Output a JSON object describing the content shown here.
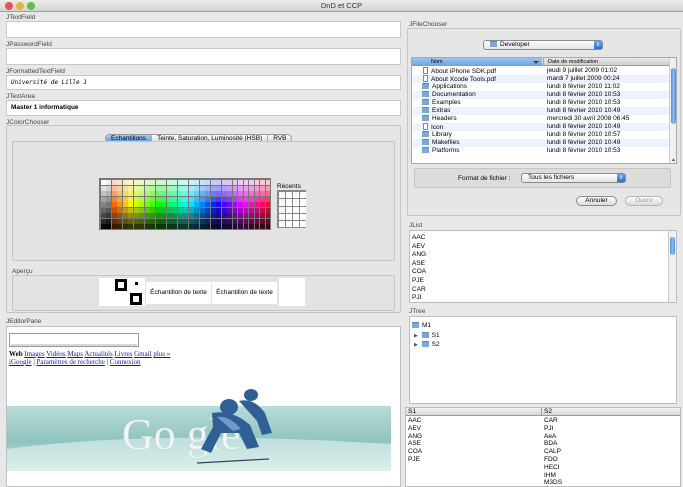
{
  "window": {
    "title": "DnD et CCP"
  },
  "colors": {
    "selection_blue": "#5d9be3",
    "list_header_blue": "#7ab0ea",
    "button_blue": "#2c6fd2"
  },
  "textfield": {
    "label": "JTextField",
    "value": ""
  },
  "passwordfield": {
    "label": "JPasswordField",
    "value": ""
  },
  "formattedfield": {
    "label": "JFormattedTextField",
    "value": "Université de Lille 1"
  },
  "textarea": {
    "label": "JTextArea",
    "value": "Master 1 informatique"
  },
  "colorchooser": {
    "label": "JColorChooser",
    "tabs": [
      "Échantillons",
      "Teinte, Saturation, Luminosité (HSB)",
      "RVB"
    ],
    "selected_tab": 0,
    "recents_label": "Récents",
    "preview_label": "Aperçu",
    "sample_text_1": "Échantillon de texte",
    "sample_text_2": "Échantillon de texte"
  },
  "editorpane": {
    "label": "JEditorPane",
    "links_row1": [
      "Web",
      "Images",
      "Vidéos",
      "Maps",
      "Actualités",
      "Livres",
      "Gmail",
      "plus »"
    ],
    "links_row2": [
      "iGoogle",
      "Paramètres de recherche",
      "Connexion"
    ],
    "sep": "|"
  },
  "filechooser": {
    "label": "JFileChooser",
    "folder": "Developer",
    "columns": [
      "Nom",
      "Date de modification"
    ],
    "files": [
      {
        "name": "About iPhone SDK.pdf",
        "date": "jeudi 9 juillet 2009 01:02",
        "icon": "document-icon"
      },
      {
        "name": "About Xcode Tools.pdf",
        "date": "mardi 7 juillet 2009 00:24",
        "icon": "document-icon"
      },
      {
        "name": "Applications",
        "date": "lundi 8 février 2010 11:02",
        "icon": "folder-icon"
      },
      {
        "name": "Documentation",
        "date": "lundi 8 février 2010 10:53",
        "icon": "folder-icon"
      },
      {
        "name": "Examples",
        "date": "lundi 8 février 2010 10:53",
        "icon": "folder-icon"
      },
      {
        "name": "Extras",
        "date": "lundi 8 février 2010 10:49",
        "icon": "folder-icon"
      },
      {
        "name": "Headers",
        "date": "mercredi 30 avril 2008 06:45",
        "icon": "folder-icon"
      },
      {
        "name": "Icon",
        "date": "lundi 8 février 2010 10:49",
        "icon": "document-icon"
      },
      {
        "name": "Library",
        "date": "lundi 8 février 2010 10:57",
        "icon": "folder-icon"
      },
      {
        "name": "Makefiles",
        "date": "lundi 8 février 2010 10:49",
        "icon": "folder-icon"
      },
      {
        "name": "Platforms",
        "date": "lundi 8 février 2010 10:53",
        "icon": "folder-icon"
      }
    ],
    "format_label": "Format de fichier :",
    "format_value": "Tous les fichiers",
    "cancel_label": "Annuler",
    "open_label": "Ouvrir"
  },
  "jlist": {
    "label": "JList",
    "items": [
      "AAC",
      "AEV",
      "ANG",
      "ASE",
      "COA",
      "PJE",
      "CAR",
      "PJI"
    ]
  },
  "jtree": {
    "label": "JTree",
    "root": "M1",
    "children": [
      "S1",
      "S2"
    ]
  },
  "jtable": {
    "columns": [
      "S1",
      "S2"
    ],
    "col1": [
      "AAC",
      "AEV",
      "ANG",
      "ASE",
      "COA",
      "PJE"
    ],
    "col2": [
      "CAR",
      "PJI",
      "AeA",
      "BDA",
      "CALP",
      "FDO",
      "HECI",
      "IHM",
      "M3DS"
    ]
  }
}
